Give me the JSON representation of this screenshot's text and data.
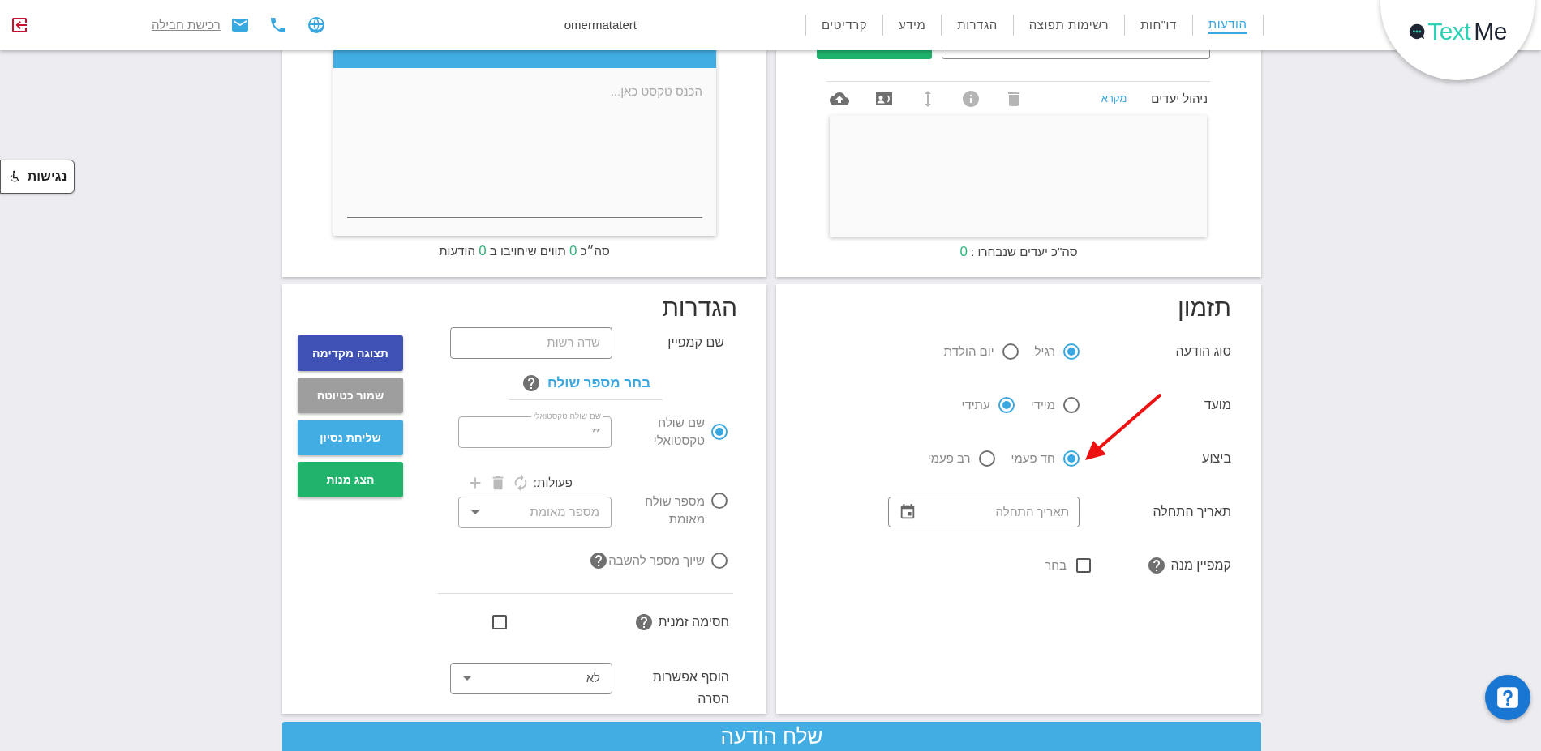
{
  "header": {
    "logo": [
      {
        "text": "Me",
        "color": "#1f2433"
      },
      {
        "text": "Text",
        "color": "#2fd1b4"
      }
    ],
    "nav": [
      {
        "label": "הודעות",
        "selected": true
      },
      {
        "label": "דו\"חות",
        "selected": false
      },
      {
        "label": "רשימות תפוצה",
        "selected": false
      },
      {
        "label": "הגדרות",
        "selected": false
      },
      {
        "label": "מידע",
        "selected": false
      },
      {
        "label": "קרדיטים",
        "selected": false
      }
    ],
    "username": "omermatatert",
    "buy_link": "רכישת חבילה"
  },
  "accessibility_button": "נגישות",
  "recipients": {
    "title": "ניהול יעדים",
    "legend": "מקרא",
    "summary": [
      {
        "kind": "text",
        "text": "סה\"כ יעדים שנבחרו :"
      },
      {
        "kind": "count",
        "text": "0"
      }
    ]
  },
  "editor": {
    "placeholder": "הכנס טקסט כאן...",
    "summary": [
      {
        "kind": "text",
        "text": "סה״כ"
      },
      {
        "kind": "count",
        "text": "0"
      },
      {
        "kind": "text",
        "text": "תווים שיחויבו ב"
      },
      {
        "kind": "count",
        "text": "0"
      },
      {
        "kind": "text",
        "text": "הודעות"
      }
    ]
  },
  "scheduling": {
    "title": "תזמון",
    "rows": [
      {
        "kind": "radio",
        "label": "סוג הודעה",
        "options": [
          {
            "label": "רגיל",
            "selected": true
          },
          {
            "label": "יום הולדת",
            "selected": false
          }
        ]
      },
      {
        "kind": "radio",
        "label": "מועד",
        "options": [
          {
            "label": "מיידי",
            "selected": false
          },
          {
            "label": "עתידי",
            "selected": true
          }
        ]
      },
      {
        "kind": "radio",
        "label": "ביצוע",
        "options": [
          {
            "label": "חד פעמי",
            "selected": true
          },
          {
            "label": "רב פעמי",
            "selected": false
          }
        ]
      },
      {
        "kind": "date",
        "label": "תאריך התחלה",
        "placeholder": "תאריך התחלה"
      },
      {
        "kind": "checkbox",
        "label": "קמפיין מנה",
        "help": true,
        "option": "בחר",
        "checked": false
      }
    ]
  },
  "settings": {
    "title": "הגדרות",
    "campaign_name": {
      "label": "שם קמפיין",
      "placeholder": "שדה רשות"
    },
    "sender_link": "בחר מספר שולח",
    "sender_options": [
      {
        "kind": "text_sender",
        "label": "שם שולח טקסטואלי",
        "selected": true,
        "field_label": "שם שולח טקסטואלי",
        "value": "**"
      },
      {
        "kind": "verified",
        "label": "מספר שולח מאומת",
        "selected": false,
        "actions_label": "פעולות:",
        "placeholder": "מספר מאומת"
      },
      {
        "kind": "reply",
        "label": "שיוך מספר להשבה",
        "selected": false,
        "help": true
      }
    ],
    "temp_block": {
      "label": "חסימה זמנית",
      "checked": false
    },
    "removal": {
      "label": "הוסף אפשרות הסרה",
      "value": "לא"
    },
    "buttons": [
      {
        "label": "תצוגה מקדימה",
        "color": "#3f51b5"
      },
      {
        "label": "שמור כטיוטה",
        "color": "#9e9e9e"
      },
      {
        "label": "שליחת נסיון",
        "color": "#42ade2"
      },
      {
        "label": "הצג מנות",
        "color": "#1fb36c"
      }
    ]
  },
  "send_button": "שלח הודעה"
}
